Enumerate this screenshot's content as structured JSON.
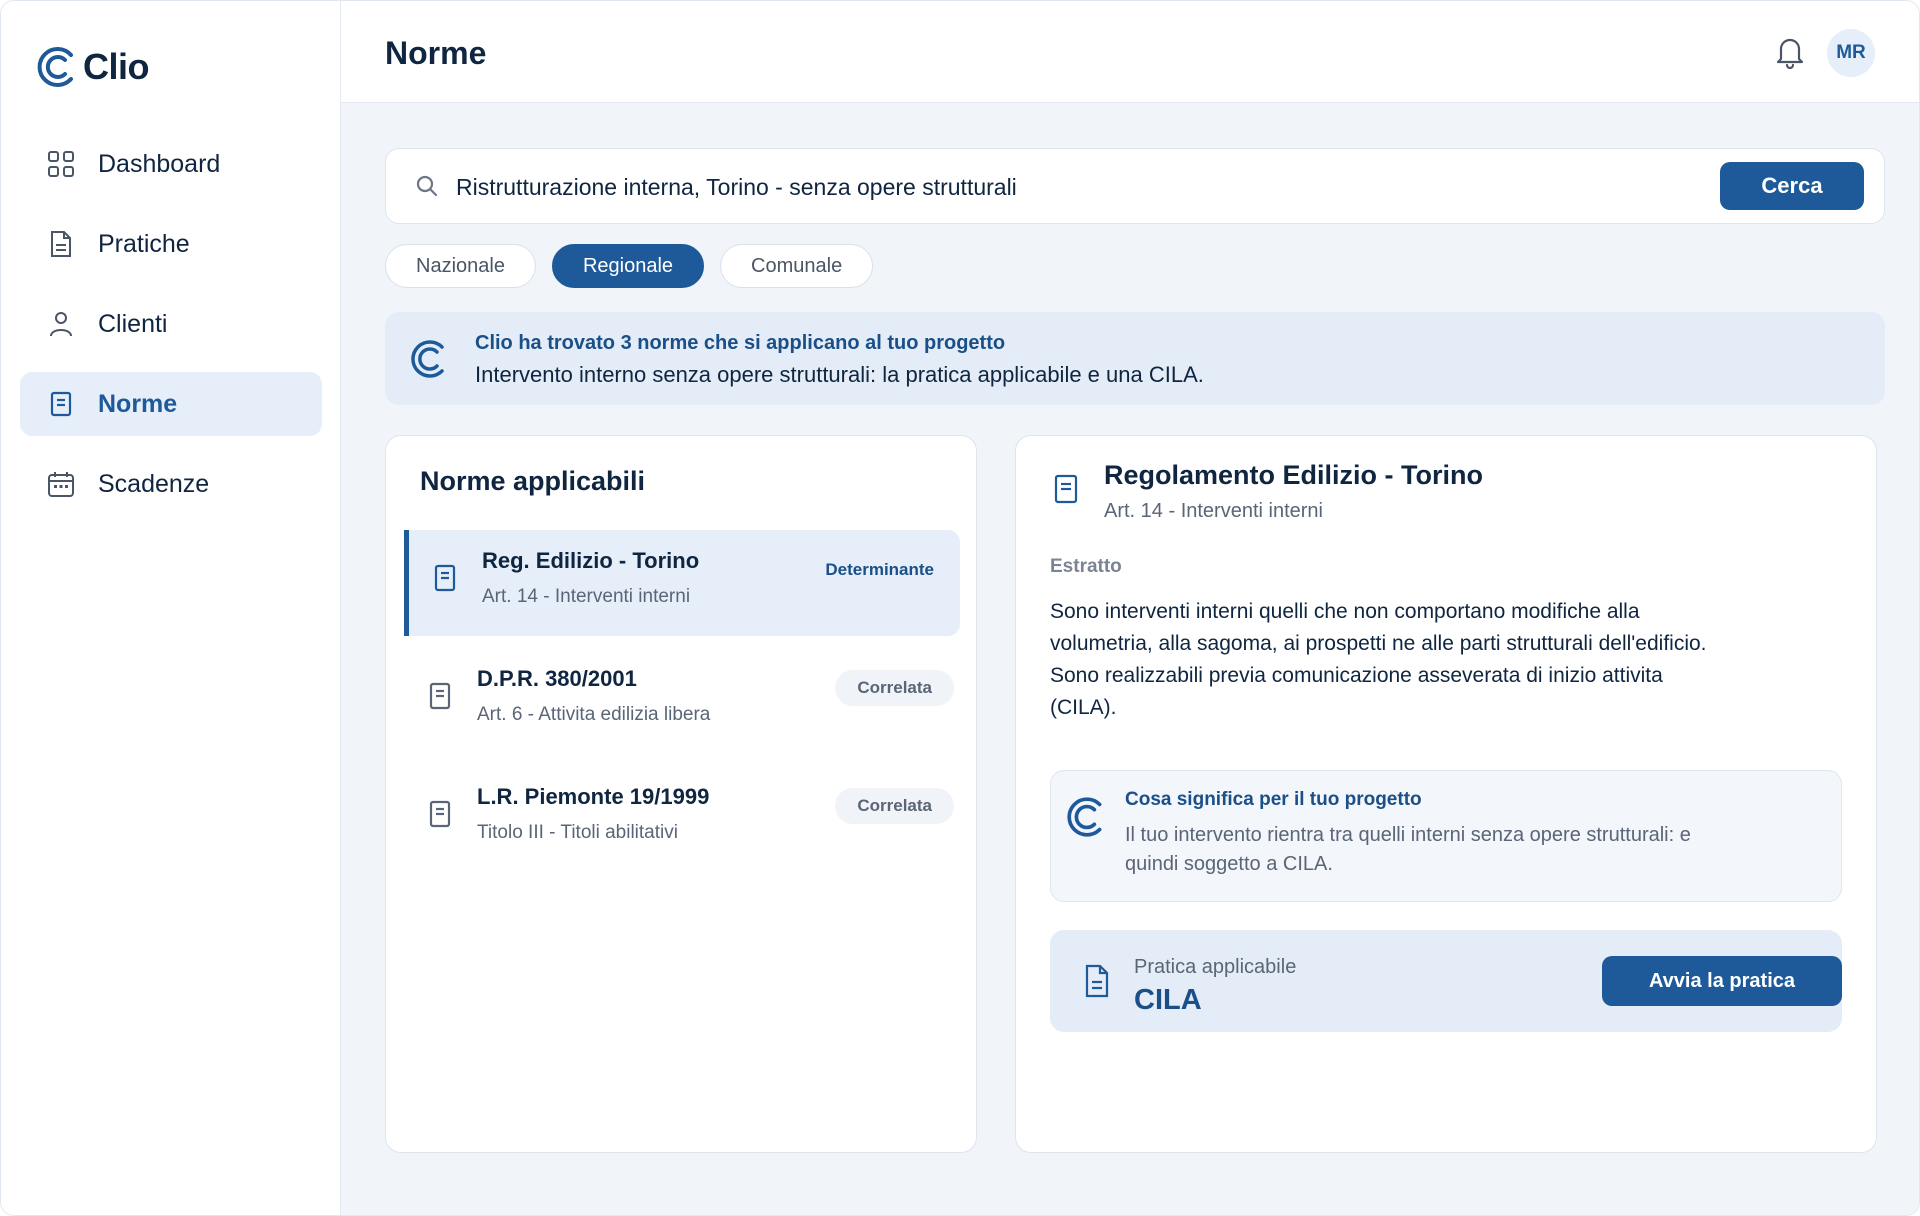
{
  "brand": {
    "name": "Clio"
  },
  "sidebar": {
    "items": [
      {
        "label": "Dashboard",
        "icon": "grid-icon"
      },
      {
        "label": "Pratiche",
        "icon": "document-icon"
      },
      {
        "label": "Clienti",
        "icon": "user-icon"
      },
      {
        "label": "Norme",
        "icon": "book-icon",
        "active": true
      },
      {
        "label": "Scadenze",
        "icon": "calendar-icon"
      }
    ]
  },
  "header": {
    "title": "Norme",
    "avatar_initials": "MR"
  },
  "search": {
    "value": "Ristrutturazione interna, Torino - senza opere strutturali",
    "button_label": "Cerca"
  },
  "filters": [
    {
      "label": "Nazionale",
      "active": false
    },
    {
      "label": "Regionale",
      "active": true
    },
    {
      "label": "Comunale",
      "active": false
    }
  ],
  "banner": {
    "title": "Clio ha trovato 3 norme che si applicano al tuo progetto",
    "text": "Intervento interno senza opere strutturali: la pratica applicabile e una CILA."
  },
  "list": {
    "title": "Norme applicabili",
    "items": [
      {
        "title": "Reg. Edilizio - Torino",
        "subtitle": "Art. 14 - Interventi interni",
        "badge": "Determinante"
      },
      {
        "title": "D.P.R. 380/2001",
        "subtitle": "Art. 6 - Attivita edilizia libera",
        "badge": "Correlata"
      },
      {
        "title": "L.R. Piemonte 19/1999",
        "subtitle": "Titolo III - Titoli abilitativi",
        "badge": "Correlata"
      }
    ]
  },
  "detail": {
    "title": "Regolamento Edilizio - Torino",
    "subtitle": "Art. 14 - Interventi interni",
    "estratto_label": "Estratto",
    "estratto_text": "Sono interventi interni quelli che non comportano modifiche alla volumetria, alla sagoma, ai prospetti ne alle parti strutturali dell'edificio. Sono realizzabili previa comunicazione asseverata di inizio attivita (CILA).",
    "meaning_title": "Cosa significa per il tuo progetto",
    "meaning_text": "Il tuo intervento rientra tra quelli interni senza opere strutturali: e quindi soggetto a CILA.",
    "pratica_label": "Pratica applicabile",
    "pratica_value": "CILA",
    "pratica_button": "Avvia la pratica"
  },
  "colors": {
    "accent": "#1e5a99",
    "accent_soft": "#e5eef9",
    "text": "#0f2540",
    "muted": "#5a6577"
  }
}
